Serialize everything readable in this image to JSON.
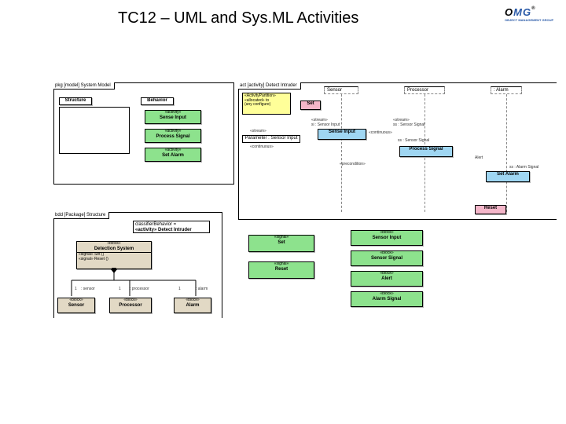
{
  "title": "TC12 – UML and Sys.ML Activities",
  "logo": {
    "text_black": "O",
    "text_blue": "MG",
    "reg": "®",
    "sub": "OBJECT MANAGEMENT GROUP"
  },
  "frames": {
    "pkg_model": "pkg [model] System Model",
    "bdd_package": "bdd [Package] Structure",
    "act_detect": "act [activity] Detect Intruder"
  },
  "packages": {
    "structure": "Structure",
    "behavior": "Behavior"
  },
  "activities": {
    "ster": "«activity»",
    "sense": "Sense Input",
    "process": "Process Signal",
    "set_alarm": "Set Alarm"
  },
  "alloc_note": {
    "l1": "«ActivityPartition»",
    "l2": "«allocated» to",
    "l3": "(any configure)"
  },
  "lifelines": {
    "sensor": "Sensor",
    "processor": "Processor",
    "alarm": ": Alarm"
  },
  "seq_actions": {
    "set": "Set",
    "sense_input": "Sense Input",
    "process_signal": "Process Signal",
    "set_alarm": "Set Alarm",
    "reset": "Reset"
  },
  "seq_labels": {
    "stream": "«stream»",
    "param": "Parameter : Sensor Input",
    "continuous": "«continuous»",
    "ss_out": "ss : Sensor Signal",
    "si_in": "si : Sensor Input",
    "alert": "Alert",
    "alarm_signal": "ss : Alarm Signal",
    "precond": "«precondition»",
    "reset_ev": "Reset"
  },
  "bdd": {
    "classifier": "classifierBehavior =",
    "det_intruder": "«activity» Detect Intruder",
    "block": "«block»",
    "detection": "Detection System",
    "sig_set": "«signal» Set ()",
    "sig_reset": "«signal» Reset ()",
    "sensor": "Sensor",
    "processor": "Processor",
    "alarm": "Alarm",
    "role_sensor": ": sensor",
    "role_processor": ": processor",
    "role_alarm": ": alarm",
    "mult": "1"
  },
  "signals": {
    "sig": "«signal»",
    "set": "Set",
    "reset": "Reset"
  },
  "right_blocks": {
    "block": "«block»",
    "sensor_input": "Sensor Input",
    "sensor_signal": "Sensor Signal",
    "alert": "Alert",
    "alarm_signal": "Alarm Signal"
  }
}
